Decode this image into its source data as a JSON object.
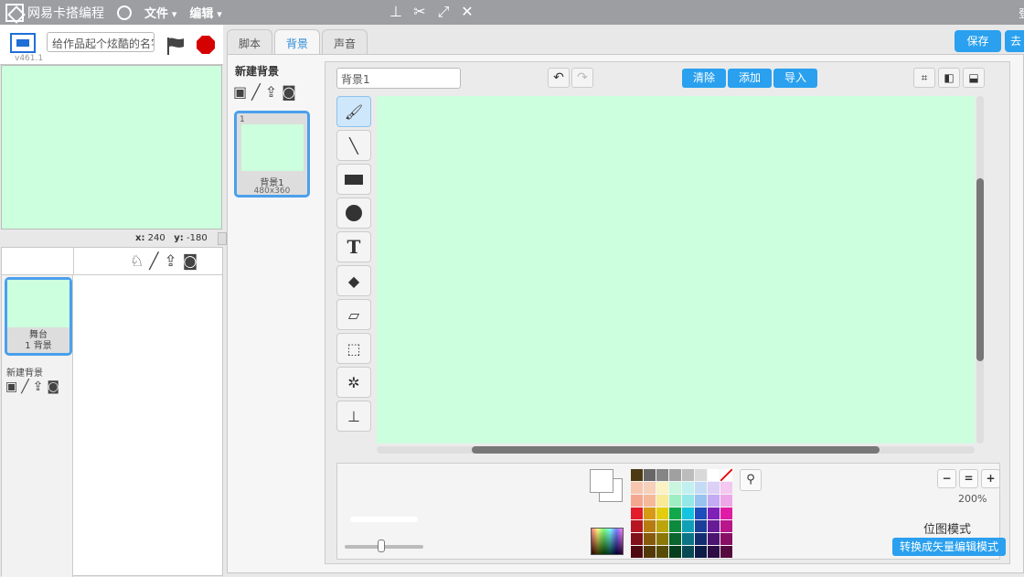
{
  "topbar": {
    "app_name": "网易卡搭编程",
    "menu_file": "文件",
    "menu_edit": "编辑",
    "login": "登"
  },
  "stage": {
    "version": "v461.1",
    "title_placeholder": "给作品起个炫酷的名字吧",
    "x_label": "x:",
    "x_value": "240",
    "y_label": "y:",
    "y_value": "-180",
    "color": "#ccffdd"
  },
  "sprites": {
    "stage_name": "舞台",
    "stage_count": "1 背景",
    "new_backdrop_label": "新建背景"
  },
  "tabs": [
    "脚本",
    "背景",
    "声音"
  ],
  "header_buttons": {
    "save": "保存",
    "to": "去"
  },
  "costumes": {
    "title": "新建背景",
    "items": [
      {
        "index": "1",
        "name": "背景1",
        "size": "480x360"
      }
    ]
  },
  "editor": {
    "name_value": "背景1",
    "actions": {
      "clear": "清除",
      "add": "添加",
      "import": "导入"
    },
    "tools": [
      "brush-icon",
      "line-icon",
      "rectangle-icon",
      "ellipse-icon",
      "text-icon",
      "fill-icon",
      "eraser-icon",
      "select-icon",
      "magic-select-icon",
      "stamp-icon"
    ],
    "zoom_level": "200%",
    "mode": "位图模式",
    "convert": "转换成矢量编辑模式"
  },
  "palette": [
    "#4d3a12",
    "#676767",
    "#858585",
    "#a0a0a0",
    "#bcbcbc",
    "#d9d9d9",
    "#ffffff",
    "transparent",
    "#f6c6ae",
    "#f6d0bb",
    "#fbf3c4",
    "#c9f6de",
    "#c2f0f0",
    "#c3dcf6",
    "#dcd0f7",
    "#f4c8f0",
    "#f5a68f",
    "#f5b99a",
    "#f8ea97",
    "#9eeec3",
    "#94e7e7",
    "#98c2f0",
    "#c4aaf3",
    "#eda6e7",
    "#e21c2a",
    "#d79a17",
    "#e4cc10",
    "#11a84c",
    "#14c3df",
    "#1e4ebd",
    "#7f21b8",
    "#e01ba5",
    "#b51622",
    "#b67c12",
    "#bca50c",
    "#0e8a3f",
    "#0fa0b7",
    "#1a3f9b",
    "#681b97",
    "#b8168a",
    "#801019",
    "#855a0d",
    "#8b7808",
    "#0a652e",
    "#0b7587",
    "#132e70",
    "#4c146f",
    "#871065",
    "#4f0a10",
    "#533808",
    "#574b05",
    "#063f1d",
    "#074954",
    "#0c1c46",
    "#2f0c45",
    "#540a3f"
  ]
}
